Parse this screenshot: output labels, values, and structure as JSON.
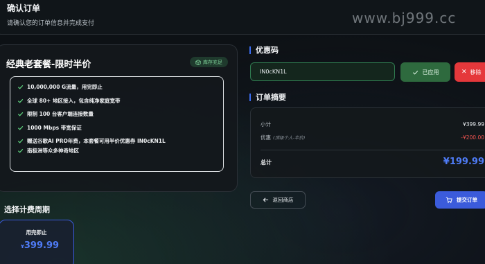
{
  "header": {
    "title": "确认订单",
    "subtitle": "请确认您的订单信息并完成支付",
    "watermark": "www.bj999.cc"
  },
  "plan": {
    "title": "经典老套餐-限时半价",
    "stock_badge": "库存充足",
    "features": [
      "10,000,000 G流量，用完即止",
      "全球 80+ 地区接入，包含纯净家庭宽带",
      "限制 100 台客户端连接数量",
      "1000 Mbps 带宽保证",
      "赠送谷歌AI PRO年费，本套餐可用半价优惠券 IN0cKN1L",
      "南极洲等众多神奇地区"
    ]
  },
  "billing": {
    "title": "选择计费周期",
    "period": {
      "label": "用完即止",
      "currency": "¥",
      "price": "399.99"
    }
  },
  "coupon": {
    "title": "优惠码",
    "value": "IN0cKN1L",
    "applied_label": "已应用",
    "remove_label": "移除"
  },
  "summary": {
    "title": "订单摘要",
    "subtotal_label": "小计",
    "subtotal_value": "¥399.99",
    "discount_label": "优惠",
    "discount_note": "(顶级个人-半价)",
    "discount_value": "-¥200.00",
    "total_label": "总计",
    "total_value": "¥199.99"
  },
  "actions": {
    "back_label": "返回商店",
    "submit_label": "提交订单"
  },
  "colors": {
    "accent": "#3b5bdb",
    "success": "#2e6a3e",
    "danger": "#e5383b",
    "check": "#5fd07e"
  }
}
